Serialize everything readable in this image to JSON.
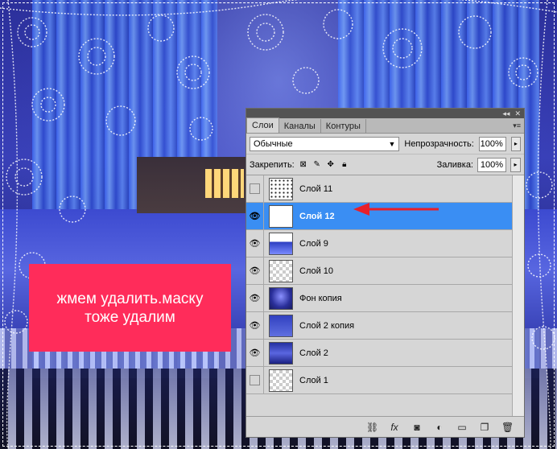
{
  "annotation": {
    "line1": "жмем удалить.маску",
    "line2": "тоже удалим"
  },
  "panel": {
    "tabs": [
      "Слои",
      "Каналы",
      "Контуры"
    ],
    "active_tab": "Слои",
    "blend_mode": "Обычные",
    "opacity_label": "Непрозрачность:",
    "opacity_value": "100%",
    "lock_label": "Закрепить:",
    "fill_label": "Заливка:",
    "fill_value": "100%",
    "layers": [
      {
        "name": "Слой 11",
        "visible": false,
        "thumb": "scatter",
        "selected": false
      },
      {
        "name": "Слой 12",
        "visible": true,
        "thumb": "white",
        "selected": true
      },
      {
        "name": "Слой 9",
        "visible": true,
        "thumb": "spikes",
        "selected": false
      },
      {
        "name": "Слой 10",
        "visible": true,
        "thumb": "checker",
        "selected": false
      },
      {
        "name": "Фон копия",
        "visible": true,
        "thumb": "blue-night",
        "selected": false
      },
      {
        "name": "Слой 2 копия",
        "visible": true,
        "thumb": "blue-pat",
        "selected": false
      },
      {
        "name": "Слой 2",
        "visible": true,
        "thumb": "blue-dark",
        "selected": false
      },
      {
        "name": "Слой 1",
        "visible": false,
        "thumb": "checker",
        "selected": false
      }
    ],
    "bottom_icons": [
      "link-icon",
      "fx-icon",
      "mask-icon",
      "adjustment-icon",
      "group-folder-icon",
      "new-layer-icon",
      "trash-icon"
    ]
  },
  "colors": {
    "callout": "#ff2c5a",
    "selection": "#3a8ef3",
    "arrow": "#e8202a"
  }
}
